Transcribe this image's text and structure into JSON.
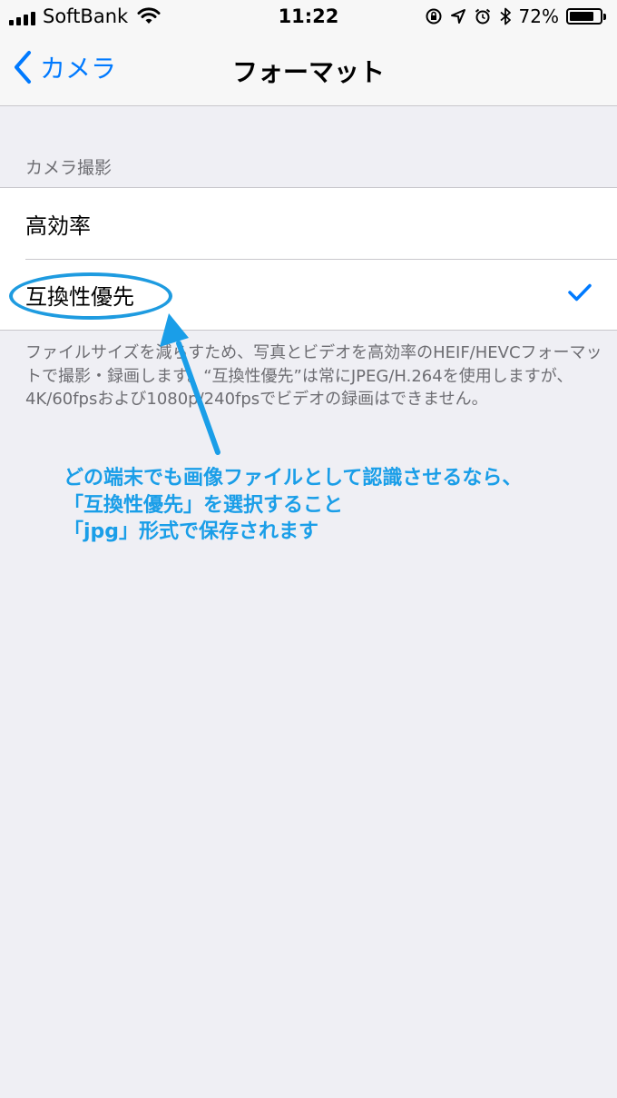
{
  "status_bar": {
    "carrier": "SoftBank",
    "time": "11:22",
    "battery_percent": "72%"
  },
  "nav": {
    "back_label": "カメラ",
    "title": "フォーマット"
  },
  "section": {
    "header": "カメラ撮影",
    "options": [
      {
        "label": "高効率"
      },
      {
        "label": "互換性優先"
      }
    ],
    "footer": "ファイルサイズを減らすため、写真とビデオを高効率のHEIF/HEVCフォーマットで撮影・録画します。“互換性優先”は常にJPEG/H.264を使用しますが、4K/60fpsおよび1080p/240fpsでビデオの録画はできません。"
  },
  "annotation": {
    "lines": [
      "どの端末でも画像ファイルとして認識させるなら、",
      "「互換性優先」を選択すること",
      "「jpg」形式で保存されます"
    ]
  },
  "colors": {
    "accent": "#007aff",
    "annotation": "#1a9ee8"
  }
}
